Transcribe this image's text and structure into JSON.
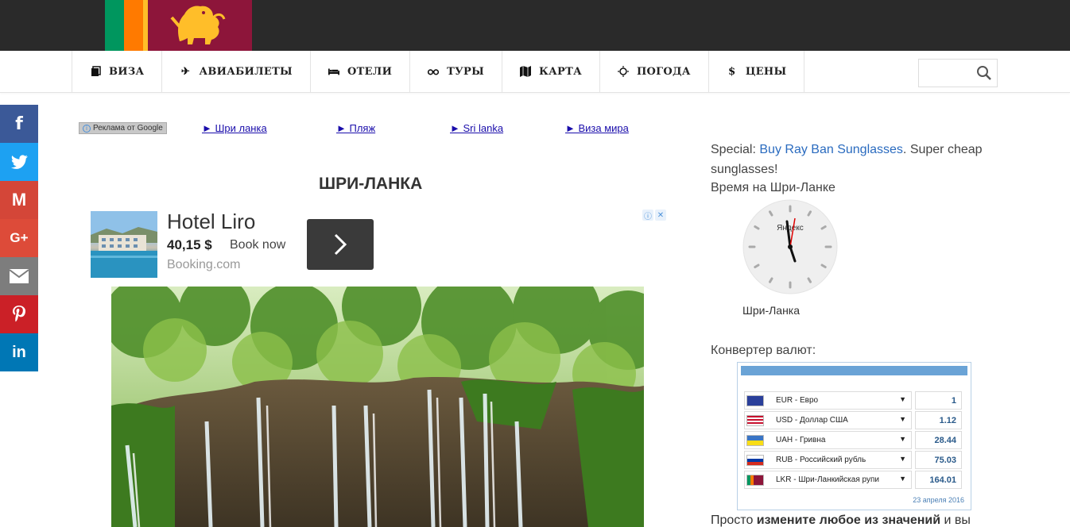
{
  "nav": {
    "items": [
      {
        "label": "ВИЗА",
        "icon": "passport-icon"
      },
      {
        "label": "АВИАБИЛЕТЫ",
        "icon": "airplane-icon"
      },
      {
        "label": "ОТЕЛИ",
        "icon": "bed-icon"
      },
      {
        "label": "ТУРЫ",
        "icon": "binoculars-icon"
      },
      {
        "label": "КАРТА",
        "icon": "map-icon"
      },
      {
        "label": "ПОГОДА",
        "icon": "sun-icon"
      },
      {
        "label": "ЦЕНЫ",
        "icon": "dollar-icon"
      }
    ],
    "search_placeholder": ""
  },
  "social": {
    "facebook": "f",
    "gmail": "M",
    "googleplus": "G+",
    "linkedin": "in"
  },
  "ads": {
    "badge": "Реклама от Google",
    "links": [
      "► Шри ланка",
      "► Пляж",
      "► Sri lanka",
      "► Виза мира"
    ]
  },
  "page": {
    "title": "ШРИ-ЛАНКА"
  },
  "hotel_ad": {
    "name": "Hotel Liro",
    "price": "40,15 $",
    "cta": "Book now",
    "site": "Booking.com"
  },
  "sidebar": {
    "special_prefix": "Special: ",
    "special_link": "Buy Ray Ban Sunglasses",
    "special_suffix": ". Super cheap sunglasses!",
    "time_label": "Время на Шри-Ланке",
    "clock_brand": "Яндекс",
    "clock_country": "Шри-Ланка",
    "converter_label": "Конвертер валют:",
    "converter": {
      "rows": [
        {
          "currency": "EUR - Евро",
          "value": "1"
        },
        {
          "currency": "USD - Доллар США",
          "value": "1.12"
        },
        {
          "currency": "UAH - Гривна",
          "value": "28.44"
        },
        {
          "currency": "RUB - Российский рубль",
          "value": "75.03"
        },
        {
          "currency": "LKR - Шри-Ланкийская рупи",
          "value": "164.01"
        }
      ],
      "date": "23 апреля 2016"
    },
    "bottom_prefix": "Просто ",
    "bottom_bold": "измените любое из значений",
    "bottom_suffix": " и вы"
  }
}
